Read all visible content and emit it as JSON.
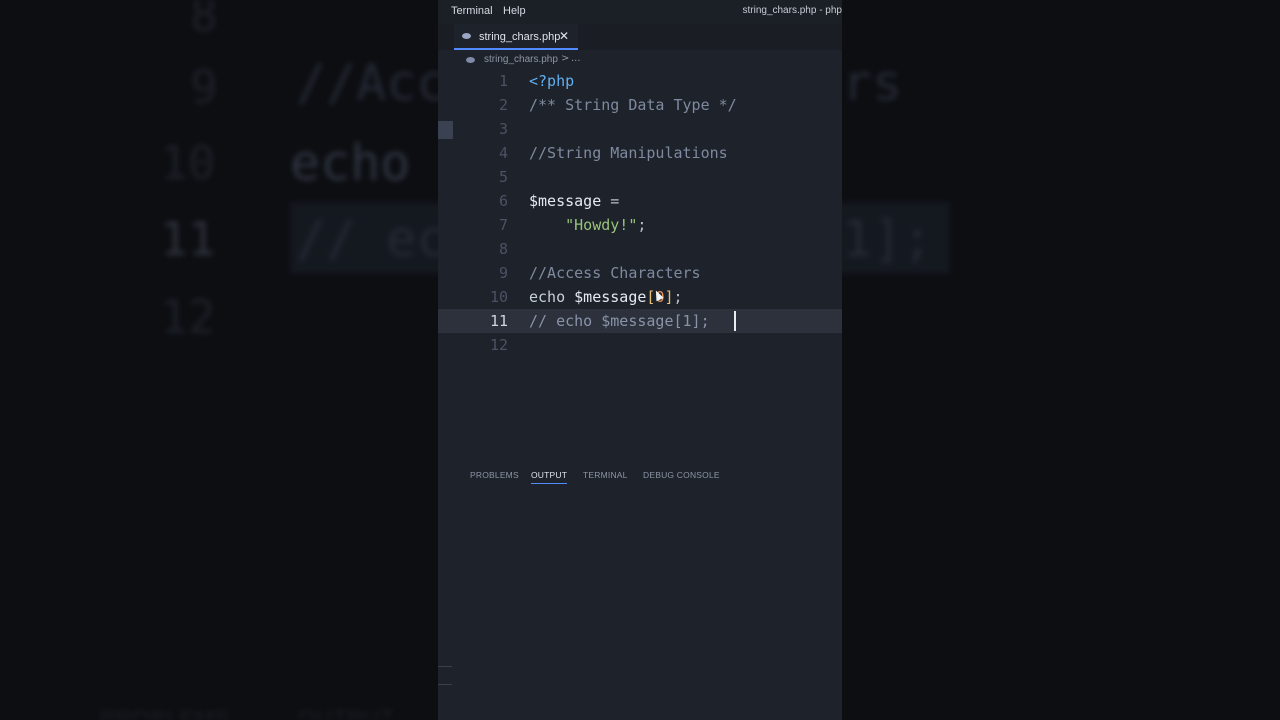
{
  "menu": {
    "items": [
      "Terminal",
      "Help"
    ]
  },
  "window": {
    "title": "string_chars.php - php"
  },
  "tab": {
    "filename": "string_chars.php",
    "close_glyph": "✕"
  },
  "breadcrumb": {
    "file": "string_chars.php",
    "separator": ">",
    "more": "..."
  },
  "editor": {
    "active_line": 11,
    "lines": [
      {
        "n": "1",
        "text": "<?php"
      },
      {
        "n": "2",
        "text": "/** String Data Type */"
      },
      {
        "n": "3",
        "text": ""
      },
      {
        "n": "4",
        "text": "//String Manipulations"
      },
      {
        "n": "5",
        "text": ""
      },
      {
        "n": "6",
        "text": "$message ="
      },
      {
        "n": "7",
        "text": "    \"Howdy!\";"
      },
      {
        "n": "8",
        "text": ""
      },
      {
        "n": "9",
        "text": "//Access Characters"
      },
      {
        "n": "10",
        "text": "echo $message[0];"
      },
      {
        "n": "11",
        "text": "// echo $message[1];"
      },
      {
        "n": "12",
        "text": ""
      }
    ],
    "tokens": {
      "l1_tag": "<?php",
      "l2_cmt": "/** String Data Type */",
      "l4_cmt": "//String Manipulations",
      "l6_var": "$message",
      "l6_op": " =",
      "l7_indent": "    ",
      "l7_str": "\"Howdy!\"",
      "l7_pun": ";",
      "l9_cmt": "//Access Characters",
      "l10_kw": "echo ",
      "l10_var": "$message",
      "l10_br_open": "[",
      "l10_num": "0",
      "l10_br_close": "]",
      "l10_pun": ";",
      "l11_cmt": "// echo $message[1];"
    }
  },
  "panel": {
    "tabs": [
      "PROBLEMS",
      "OUTPUT",
      "TERMINAL",
      "DEBUG CONSOLE"
    ],
    "active_tab": "OUTPUT"
  },
  "background": {
    "lines": [
      "//Acc",
      "rs",
      "echo",
      "//  ec",
      "1];"
    ],
    "numbers": [
      "8",
      "9",
      "10",
      "11",
      "12"
    ],
    "panel_labels": [
      "PROBLEMS",
      "OUTPUT"
    ]
  }
}
